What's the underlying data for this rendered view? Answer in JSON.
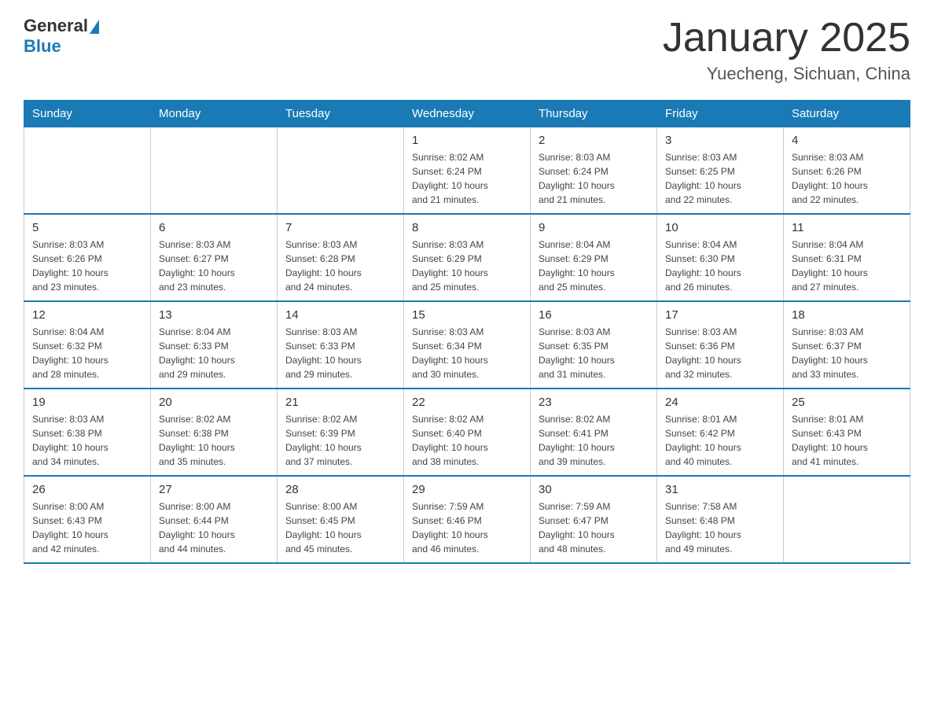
{
  "header": {
    "logo_general": "General",
    "logo_blue": "Blue",
    "title": "January 2025",
    "subtitle": "Yuecheng, Sichuan, China"
  },
  "weekdays": [
    "Sunday",
    "Monday",
    "Tuesday",
    "Wednesday",
    "Thursday",
    "Friday",
    "Saturday"
  ],
  "weeks": [
    [
      {
        "day": "",
        "info": ""
      },
      {
        "day": "",
        "info": ""
      },
      {
        "day": "",
        "info": ""
      },
      {
        "day": "1",
        "info": "Sunrise: 8:02 AM\nSunset: 6:24 PM\nDaylight: 10 hours\nand 21 minutes."
      },
      {
        "day": "2",
        "info": "Sunrise: 8:03 AM\nSunset: 6:24 PM\nDaylight: 10 hours\nand 21 minutes."
      },
      {
        "day": "3",
        "info": "Sunrise: 8:03 AM\nSunset: 6:25 PM\nDaylight: 10 hours\nand 22 minutes."
      },
      {
        "day": "4",
        "info": "Sunrise: 8:03 AM\nSunset: 6:26 PM\nDaylight: 10 hours\nand 22 minutes."
      }
    ],
    [
      {
        "day": "5",
        "info": "Sunrise: 8:03 AM\nSunset: 6:26 PM\nDaylight: 10 hours\nand 23 minutes."
      },
      {
        "day": "6",
        "info": "Sunrise: 8:03 AM\nSunset: 6:27 PM\nDaylight: 10 hours\nand 23 minutes."
      },
      {
        "day": "7",
        "info": "Sunrise: 8:03 AM\nSunset: 6:28 PM\nDaylight: 10 hours\nand 24 minutes."
      },
      {
        "day": "8",
        "info": "Sunrise: 8:03 AM\nSunset: 6:29 PM\nDaylight: 10 hours\nand 25 minutes."
      },
      {
        "day": "9",
        "info": "Sunrise: 8:04 AM\nSunset: 6:29 PM\nDaylight: 10 hours\nand 25 minutes."
      },
      {
        "day": "10",
        "info": "Sunrise: 8:04 AM\nSunset: 6:30 PM\nDaylight: 10 hours\nand 26 minutes."
      },
      {
        "day": "11",
        "info": "Sunrise: 8:04 AM\nSunset: 6:31 PM\nDaylight: 10 hours\nand 27 minutes."
      }
    ],
    [
      {
        "day": "12",
        "info": "Sunrise: 8:04 AM\nSunset: 6:32 PM\nDaylight: 10 hours\nand 28 minutes."
      },
      {
        "day": "13",
        "info": "Sunrise: 8:04 AM\nSunset: 6:33 PM\nDaylight: 10 hours\nand 29 minutes."
      },
      {
        "day": "14",
        "info": "Sunrise: 8:03 AM\nSunset: 6:33 PM\nDaylight: 10 hours\nand 29 minutes."
      },
      {
        "day": "15",
        "info": "Sunrise: 8:03 AM\nSunset: 6:34 PM\nDaylight: 10 hours\nand 30 minutes."
      },
      {
        "day": "16",
        "info": "Sunrise: 8:03 AM\nSunset: 6:35 PM\nDaylight: 10 hours\nand 31 minutes."
      },
      {
        "day": "17",
        "info": "Sunrise: 8:03 AM\nSunset: 6:36 PM\nDaylight: 10 hours\nand 32 minutes."
      },
      {
        "day": "18",
        "info": "Sunrise: 8:03 AM\nSunset: 6:37 PM\nDaylight: 10 hours\nand 33 minutes."
      }
    ],
    [
      {
        "day": "19",
        "info": "Sunrise: 8:03 AM\nSunset: 6:38 PM\nDaylight: 10 hours\nand 34 minutes."
      },
      {
        "day": "20",
        "info": "Sunrise: 8:02 AM\nSunset: 6:38 PM\nDaylight: 10 hours\nand 35 minutes."
      },
      {
        "day": "21",
        "info": "Sunrise: 8:02 AM\nSunset: 6:39 PM\nDaylight: 10 hours\nand 37 minutes."
      },
      {
        "day": "22",
        "info": "Sunrise: 8:02 AM\nSunset: 6:40 PM\nDaylight: 10 hours\nand 38 minutes."
      },
      {
        "day": "23",
        "info": "Sunrise: 8:02 AM\nSunset: 6:41 PM\nDaylight: 10 hours\nand 39 minutes."
      },
      {
        "day": "24",
        "info": "Sunrise: 8:01 AM\nSunset: 6:42 PM\nDaylight: 10 hours\nand 40 minutes."
      },
      {
        "day": "25",
        "info": "Sunrise: 8:01 AM\nSunset: 6:43 PM\nDaylight: 10 hours\nand 41 minutes."
      }
    ],
    [
      {
        "day": "26",
        "info": "Sunrise: 8:00 AM\nSunset: 6:43 PM\nDaylight: 10 hours\nand 42 minutes."
      },
      {
        "day": "27",
        "info": "Sunrise: 8:00 AM\nSunset: 6:44 PM\nDaylight: 10 hours\nand 44 minutes."
      },
      {
        "day": "28",
        "info": "Sunrise: 8:00 AM\nSunset: 6:45 PM\nDaylight: 10 hours\nand 45 minutes."
      },
      {
        "day": "29",
        "info": "Sunrise: 7:59 AM\nSunset: 6:46 PM\nDaylight: 10 hours\nand 46 minutes."
      },
      {
        "day": "30",
        "info": "Sunrise: 7:59 AM\nSunset: 6:47 PM\nDaylight: 10 hours\nand 48 minutes."
      },
      {
        "day": "31",
        "info": "Sunrise: 7:58 AM\nSunset: 6:48 PM\nDaylight: 10 hours\nand 49 minutes."
      },
      {
        "day": "",
        "info": ""
      }
    ]
  ]
}
